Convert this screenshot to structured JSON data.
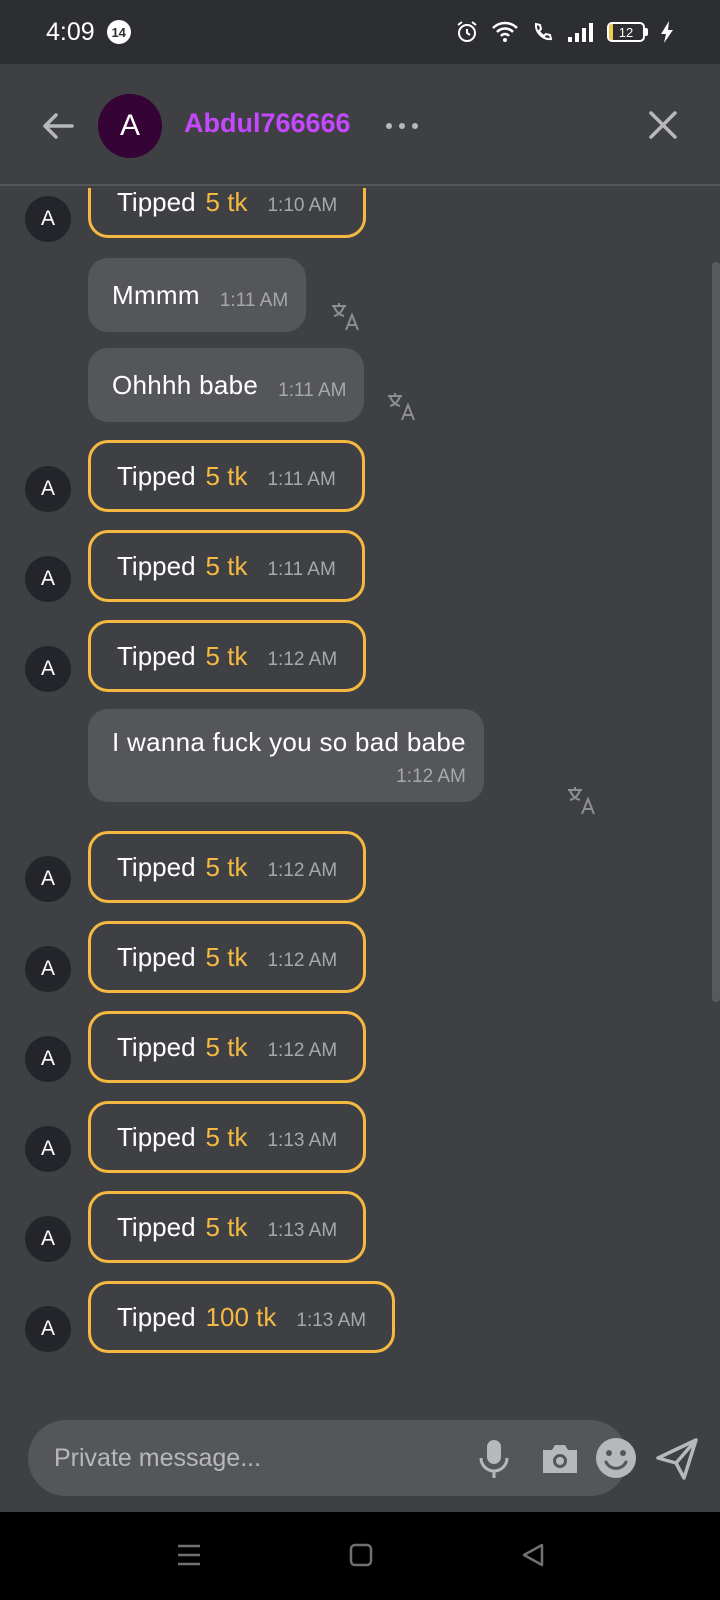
{
  "status_bar": {
    "time": "4:09",
    "notification_count": "14",
    "battery_level": "12"
  },
  "header": {
    "avatar_letter": "A",
    "username": "Abdul766666",
    "name_color": "#c548ff"
  },
  "messages": {
    "avatar_letter": "A",
    "tip_label": "Tipped",
    "accent_color": "#f5b942",
    "items": [
      {
        "type": "tip",
        "amount": "5 tk",
        "time": "1:10 AM"
      },
      {
        "type": "text",
        "text": "Mmmm",
        "time": "1:11 AM"
      },
      {
        "type": "text",
        "text": "Ohhhh babe",
        "time": "1:11 AM"
      },
      {
        "type": "tip",
        "amount": "5 tk",
        "time": "1:11 AM"
      },
      {
        "type": "tip",
        "amount": "5 tk",
        "time": "1:11 AM"
      },
      {
        "type": "tip",
        "amount": "5 tk",
        "time": "1:12 AM"
      },
      {
        "type": "text",
        "text": "I wanna fuck you so bad babe",
        "time": "1:12 AM"
      },
      {
        "type": "tip",
        "amount": "5 tk",
        "time": "1:12 AM"
      },
      {
        "type": "tip",
        "amount": "5 tk",
        "time": "1:12 AM"
      },
      {
        "type": "tip",
        "amount": "5 tk",
        "time": "1:12 AM"
      },
      {
        "type": "tip",
        "amount": "5 tk",
        "time": "1:13 AM"
      },
      {
        "type": "tip",
        "amount": "5 tk",
        "time": "1:13 AM"
      },
      {
        "type": "tip",
        "amount": "100 tk",
        "time": "1:13 AM"
      }
    ]
  },
  "composer": {
    "placeholder": "Private message..."
  },
  "icons": {
    "back": "arrow-left-icon",
    "more": "more-horizontal-icon",
    "close": "close-icon",
    "translate": "translate-icon",
    "mic": "microphone-icon",
    "camera": "camera-icon",
    "emoji": "emoji-icon",
    "send": "send-icon"
  }
}
